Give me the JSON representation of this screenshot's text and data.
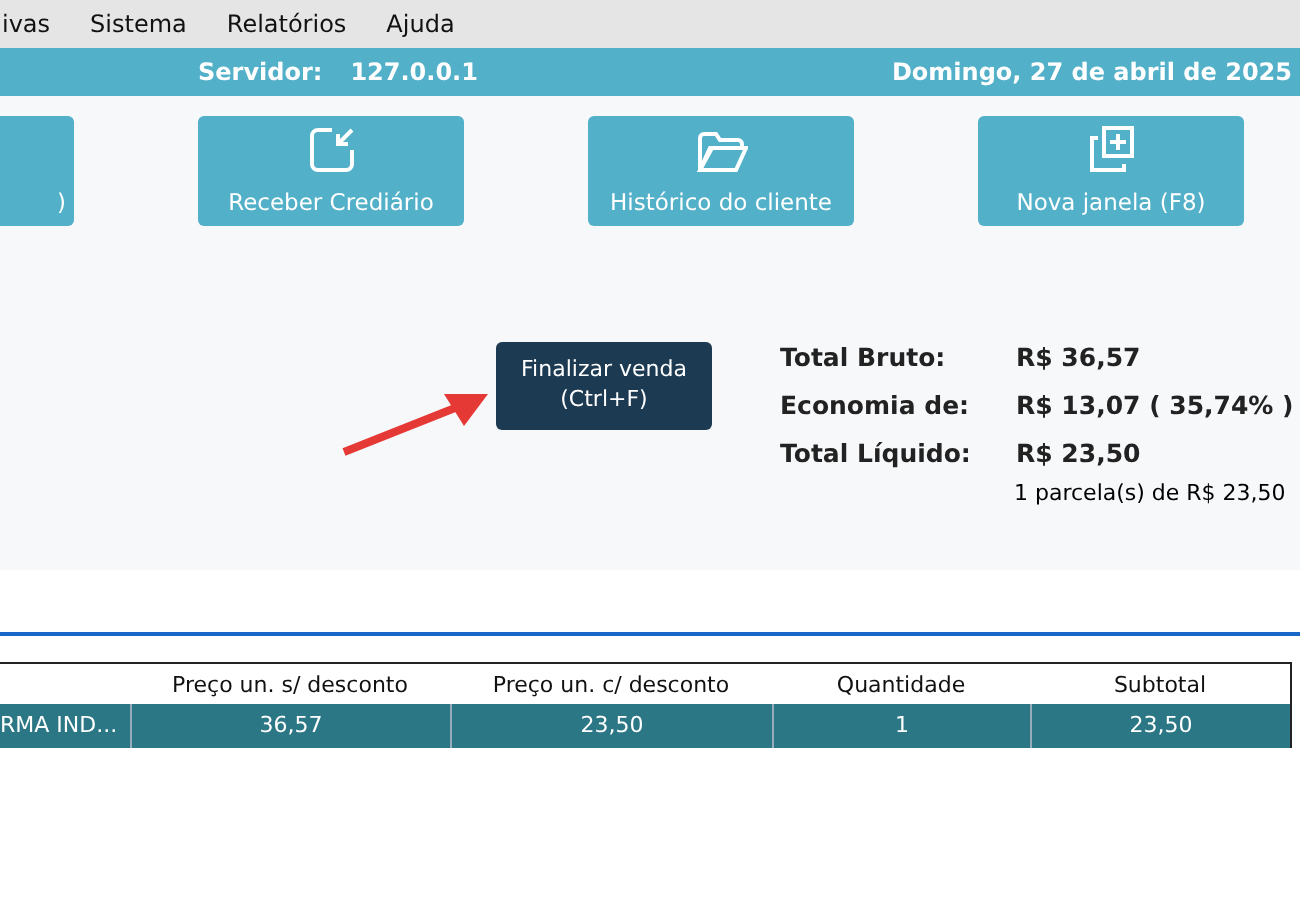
{
  "menu": [
    "ivas",
    "Sistema",
    "Relatórios",
    "Ajuda"
  ],
  "status_bar": {
    "server_label": "Servidor:",
    "server": "127.0.0.1",
    "date": "Domingo, 27 de abril de 2025"
  },
  "actions": [
    {
      "label": ")",
      "kind": "plain"
    },
    {
      "label": "Receber Crediário",
      "kind": "receive"
    },
    {
      "label": "Histórico do cliente",
      "kind": "history"
    },
    {
      "label": "Nova janela (F8)",
      "kind": "window"
    }
  ],
  "finish_button": {
    "line1": "Finalizar venda",
    "line2": "(Ctrl+F)"
  },
  "totals": [
    {
      "label": "Total Bruto:",
      "value": "R$ 36,57"
    },
    {
      "label": "Economia de:",
      "value": "R$ 13,07 ( 35,74% )"
    },
    {
      "label": "Total Líquido:",
      "value": "R$ 23,50"
    }
  ],
  "installments": "1 parcela(s) de R$ 23,50",
  "table": {
    "columns": [
      "",
      "Preço un. s/ desconto",
      "Preço un. c/ desconto",
      "Quantidade",
      "Subtotal"
    ],
    "rows": [
      {
        "selected": true,
        "cells": [
          "RMA IND...",
          "36,57",
          "23,50",
          "1",
          "23,50"
        ]
      }
    ]
  }
}
